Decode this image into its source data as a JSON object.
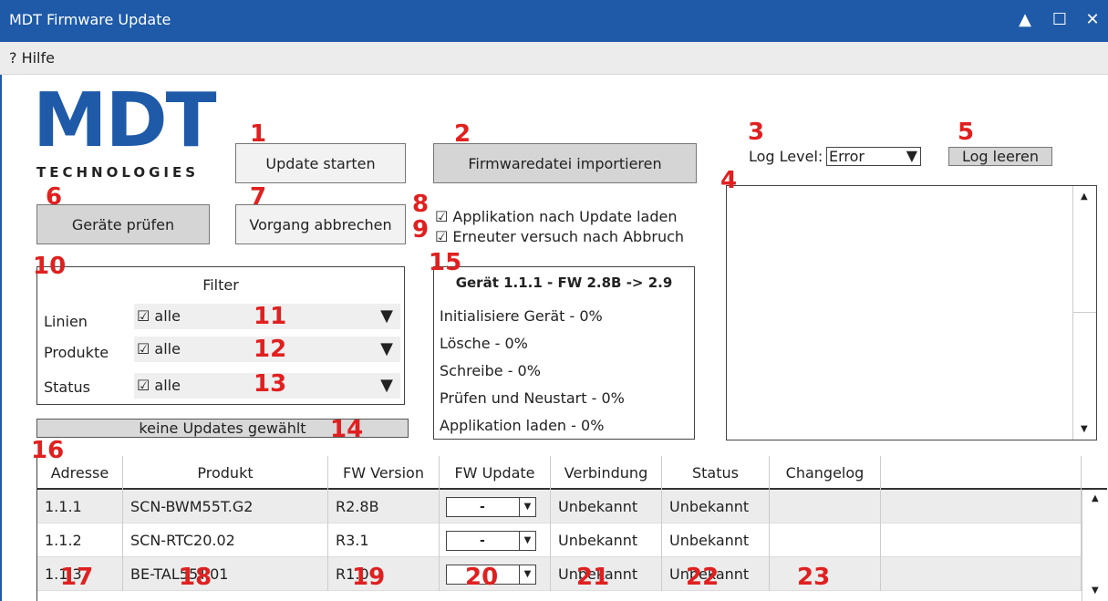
{
  "window": {
    "title": "MDT Firmware Update",
    "controls": {
      "minimize": "▲",
      "maximize": "☐",
      "close": "✕"
    }
  },
  "menu": {
    "items": [
      "? Hilfe"
    ]
  },
  "logo": {
    "brand": "MDT",
    "subtitle": "TECHNOLOGIES",
    "color": "#1e5aa8"
  },
  "buttons": {
    "update_start": "Update starten",
    "import_firmware": "Firmwaredatei importieren",
    "check_devices": "Geräte prüfen",
    "abort": "Vorgang abbrechen",
    "clear_log": "Log leeren"
  },
  "log": {
    "level_label": "Log Level:",
    "level_value": "Error",
    "arrow": "▼"
  },
  "checkboxes": {
    "load_app": "☑ Applikation nach Update laden",
    "retry": "☑ Erneuter versuch nach Abbruch"
  },
  "filter": {
    "title": "Filter",
    "rows": [
      {
        "label": "Linien",
        "value": "☑ alle"
      },
      {
        "label": "Produkte",
        "value": "☑ alle"
      },
      {
        "label": "Status",
        "value": "☑ alle"
      }
    ],
    "arrow": "▼"
  },
  "progress": {
    "text": "keine Updates gewählt"
  },
  "device": {
    "title": "Gerät 1.1.1 - FW 2.8B -> 2.9",
    "steps": [
      "Initialisiere Gerät - 0%",
      "Lösche - 0%",
      "Schreibe - 0%",
      "Prüfen und Neustart - 0%",
      "Applikation laden - 0%"
    ]
  },
  "table": {
    "headers": [
      "Adresse",
      "Produkt",
      "FW Version",
      "FW Update",
      "Verbindung",
      "Status",
      "Changelog",
      ""
    ],
    "rows": [
      {
        "address": "1.1.1",
        "product": "SCN-BWM55T.G2",
        "fw_version": "R2.8B",
        "fw_update": "-",
        "connection": "Unbekannt",
        "status": "Unbekannt",
        "changelog": ""
      },
      {
        "address": "1.1.2",
        "product": "SCN-RTC20.02",
        "fw_version": "R3.1",
        "fw_update": "-",
        "connection": "Unbekannt",
        "status": "Unbekannt",
        "changelog": ""
      },
      {
        "address": "1.1.3",
        "product": "BE-TAL55T.01",
        "fw_version": "R1.0",
        "fw_update": "",
        "connection": "Unbekannt",
        "status": "Unbekannt",
        "changelog": ""
      }
    ]
  },
  "callouts": [
    "1",
    "2",
    "3",
    "4",
    "5",
    "6",
    "7",
    "8",
    "9",
    "10",
    "11",
    "12",
    "13",
    "14",
    "15",
    "16",
    "17",
    "18",
    "19",
    "20",
    "21",
    "22",
    "23"
  ],
  "colors": {
    "titlebar": "#1e5aa8",
    "callout": "#e02020"
  }
}
